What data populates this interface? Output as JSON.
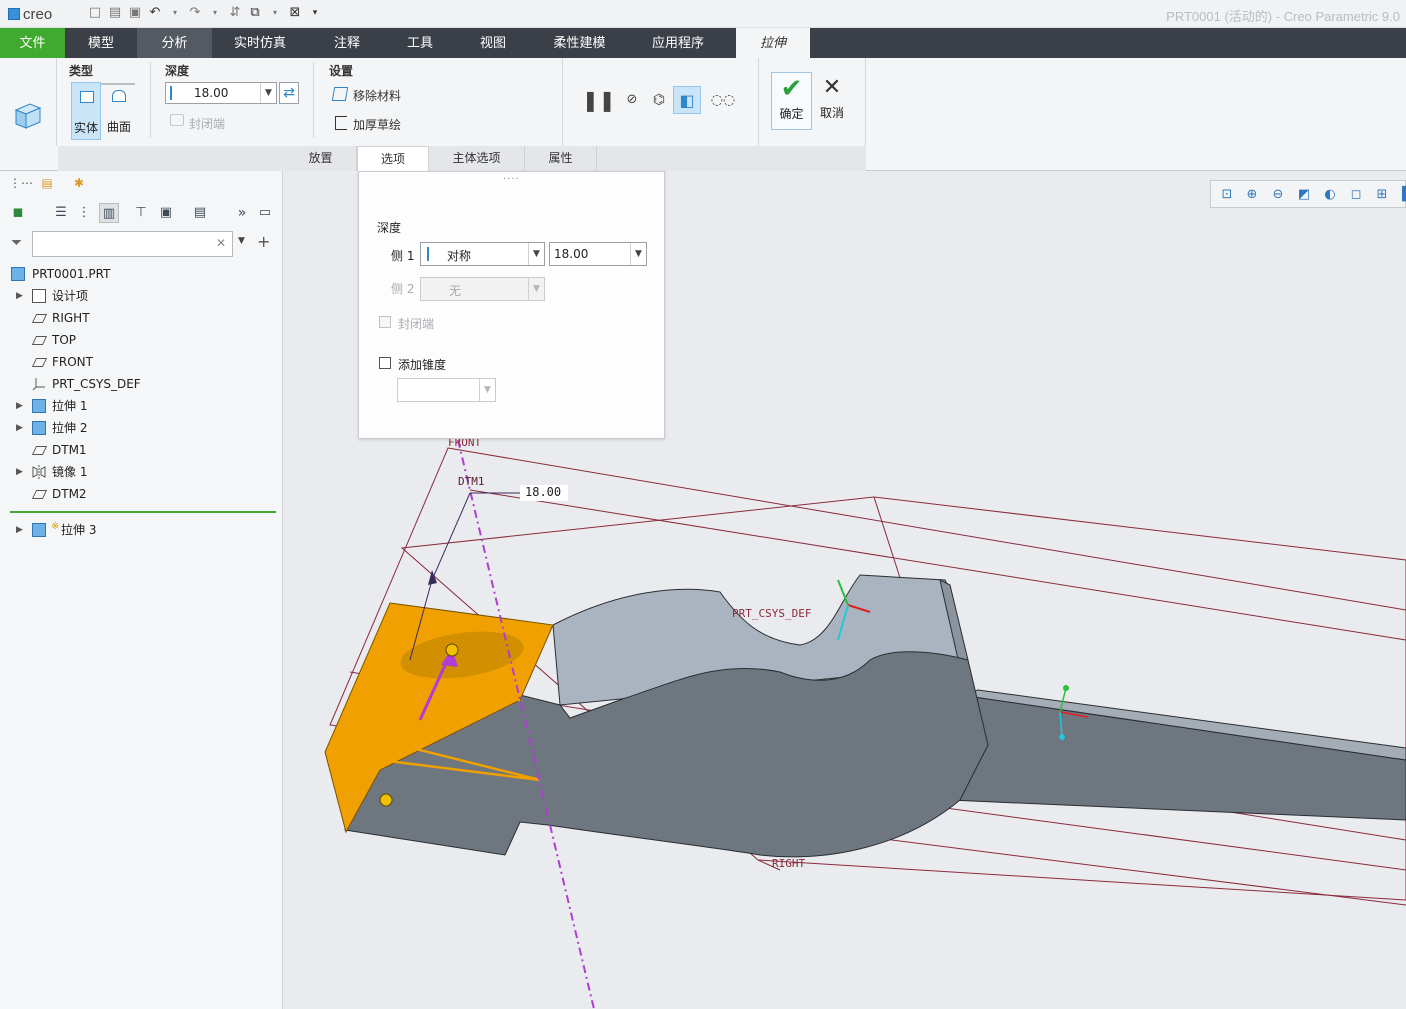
{
  "app": {
    "logo_text": "creo",
    "window_title": "PRT0001 (活动的) - Creo Parametric 9.0"
  },
  "tabs": {
    "file": "文件",
    "model": "模型",
    "analysis": "分析",
    "simulation": "实时仿真",
    "annotate": "注释",
    "tools": "工具",
    "view": "视图",
    "flexible": "柔性建模",
    "apps": "应用程序",
    "extrude": "拉伸"
  },
  "ribbon": {
    "type_group_label": "类型",
    "solid_label": "实体",
    "surface_label": "曲面",
    "depth_group_label": "深度",
    "depth_value": "18.00",
    "capped_ends_label": "封闭端",
    "settings_group_label": "设置",
    "remove_material_label": "移除材料",
    "thicken_sketch_label": "加厚草绘",
    "ok_label": "确定",
    "cancel_label": "取消",
    "slideup_tabs": {
      "placement": "放置",
      "options": "选项",
      "body_options": "主体选项",
      "properties": "属性"
    }
  },
  "options_panel": {
    "depth_label": "深度",
    "side1_label": "侧 1",
    "side1_type": "对称",
    "side1_value": "18.00",
    "side2_label": "侧 2",
    "side2_type": "无",
    "capped_ends_label": "封闭端",
    "add_taper_label": "添加锥度"
  },
  "model_tree": {
    "root": "PRT0001.PRT",
    "items": [
      {
        "label": "设计项",
        "icon": "list-icon",
        "expandable": true
      },
      {
        "label": "RIGHT",
        "icon": "datum-plane-icon",
        "expandable": false
      },
      {
        "label": "TOP",
        "icon": "datum-plane-icon",
        "expandable": false
      },
      {
        "label": "FRONT",
        "icon": "datum-plane-icon",
        "expandable": false
      },
      {
        "label": "PRT_CSYS_DEF",
        "icon": "coordinate-system-icon",
        "expandable": false
      },
      {
        "label": "拉伸 1",
        "icon": "extrude-icon",
        "expandable": true
      },
      {
        "label": "拉伸 2",
        "icon": "extrude-icon",
        "expandable": true
      },
      {
        "label": "DTM1",
        "icon": "datum-plane-icon",
        "expandable": false
      },
      {
        "label": "镜像 1",
        "icon": "mirror-icon",
        "expandable": true
      },
      {
        "label": "DTM2",
        "icon": "datum-plane-icon",
        "expandable": false
      }
    ],
    "active_item": {
      "label": "拉伸 3",
      "icon": "extrude-icon",
      "marker": "※"
    }
  },
  "graphics": {
    "labels": {
      "front": "FRONT",
      "dtm1": "DTM1",
      "dimension": "18.00",
      "csys": "PRT_CSYS_DEF",
      "right": "RIGHT"
    }
  },
  "colors": {
    "file_tab": "#3faa2d",
    "tabbar": "#3b4048",
    "accent_blue": "#2f86c9",
    "part_gray": "#6e7680",
    "sketch_orange": "#f0a000",
    "datum_lines": "#8a2a3a",
    "axis_magenta": "#b13cd6"
  }
}
